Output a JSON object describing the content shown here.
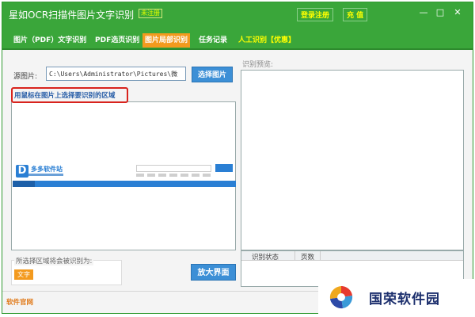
{
  "window": {
    "title": "星如OCR扫描件图片文字识别",
    "version_badge": "未注册",
    "register_label": "登录注册",
    "charge_label": "充 值",
    "minimize_glyph": "—",
    "maximize_glyph": "□",
    "close_glyph": "✕"
  },
  "tabs": [
    {
      "label": "图片（PDF）文字识别",
      "active": false
    },
    {
      "label": "PDF选页识别",
      "active": false
    },
    {
      "label": "图片局部识别",
      "active": true
    },
    {
      "label": "任务记录",
      "active": false
    },
    {
      "label": "人工识别【优惠】",
      "active": false
    }
  ],
  "source": {
    "label": "源图片:",
    "path_value": "C:\\Users\\Administrator\\Pictures\\微",
    "choose_button": "选择图片"
  },
  "hint": "用鼠标在图片上选择要识别的区域",
  "loaded_image": {
    "site_logo_mark": "D",
    "site_logo_text": "多多软件站"
  },
  "result": {
    "caption": "所选择区域将会被识别为:",
    "type_tag": "文字"
  },
  "enlarge_button": "放大界面",
  "preview": {
    "label": "识别预览:",
    "columns": [
      "识别状态",
      "页数"
    ]
  },
  "statusbar": {
    "website_link": "软件官网"
  },
  "watermark": {
    "text": "国荣软件园"
  },
  "colors": {
    "title_green": "#3aa63a",
    "active_tab_orange": "#f39a1e",
    "button_blue": "#3c8fd6",
    "hint_red_border": "#d8231d"
  },
  "icons": {
    "minimize": "minimize-icon",
    "maximize": "maximize-icon",
    "close": "close-icon",
    "watermark_logo": "colorful-swirl-logo"
  }
}
